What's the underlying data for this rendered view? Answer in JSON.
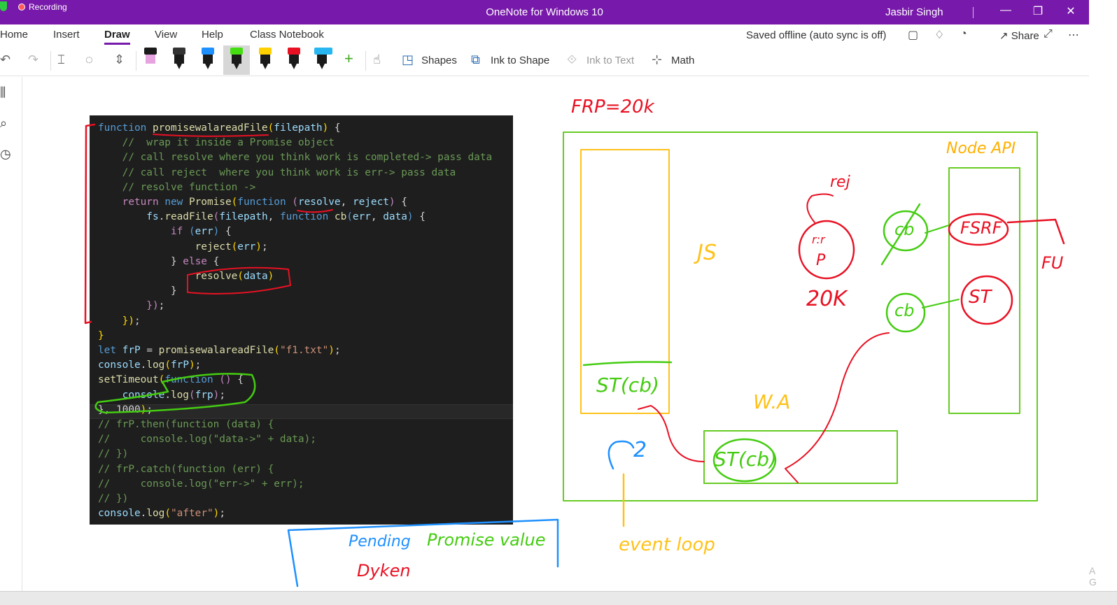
{
  "titlebar": {
    "recording": "Recording",
    "title": "OneNote for Windows 10",
    "user": "Jasbir Singh",
    "minimize": "—",
    "maximize": "❐",
    "close": "✕"
  },
  "ribbon": {
    "tabs": [
      "Home",
      "Insert",
      "Draw",
      "View",
      "Help",
      "Class Notebook"
    ],
    "active_tab": "Draw",
    "status": "Saved offline (auto sync is off)",
    "share": "Share",
    "more": "⋯"
  },
  "toolbar": {
    "shapes": "Shapes",
    "ink_to_shape": "Ink to Shape",
    "ink_to_text": "Ink to Text",
    "math": "Math",
    "add_pen": "+",
    "pens": [
      {
        "color": "#e7a3e0",
        "name": "pink-highlighter-pen"
      },
      {
        "color": "#222222",
        "name": "black-pen"
      },
      {
        "color": "#1e90ff",
        "name": "blue-pen"
      },
      {
        "color": "#44dd11",
        "name": "green-pen"
      },
      {
        "color": "#ffd000",
        "name": "yellow-pen"
      },
      {
        "color": "#e81123",
        "name": "red-pen"
      },
      {
        "color": "#27b6f0",
        "name": "cyan-pen"
      }
    ],
    "selected_pen": "green-pen"
  },
  "code": {
    "lines": [
      [
        [
          "k",
          "function "
        ],
        [
          "f",
          "promisewalareadFile"
        ],
        [
          "br",
          "("
        ],
        [
          "v",
          "filepath"
        ],
        [
          "br",
          ")"
        ],
        [
          "p",
          " {"
        ]
      ],
      [
        [
          "c",
          "    //  wrap it inside a Promise object"
        ]
      ],
      [
        [
          "c",
          "    // call resolve where you think work is completed-> pass data"
        ]
      ],
      [
        [
          "c",
          "    // call reject  where you think work is err-> pass data"
        ]
      ],
      [
        [
          "c",
          "    // resolve function ->"
        ]
      ],
      [
        [
          "kw2",
          "    return "
        ],
        [
          "k",
          "new "
        ],
        [
          "f",
          "Promise"
        ],
        [
          "br",
          "("
        ],
        [
          "k",
          "function "
        ],
        [
          "kw2",
          "("
        ],
        [
          "v",
          "resolve"
        ],
        [
          "p",
          ", "
        ],
        [
          "v",
          "reject"
        ],
        [
          "kw2",
          ")"
        ],
        [
          "p",
          " {"
        ]
      ],
      [
        [
          "v",
          "        fs"
        ],
        [
          "p",
          "."
        ],
        [
          "f",
          "readFile"
        ],
        [
          "kw2",
          "("
        ],
        [
          "v",
          "filepath"
        ],
        [
          "p",
          ", "
        ],
        [
          "k",
          "function "
        ],
        [
          "f",
          "cb"
        ],
        [
          "k",
          "("
        ],
        [
          "v",
          "err"
        ],
        [
          "p",
          ", "
        ],
        [
          "v",
          "data"
        ],
        [
          "k",
          ")"
        ],
        [
          "p",
          " {"
        ]
      ],
      [
        [
          "kw2",
          "            if "
        ],
        [
          "k",
          "("
        ],
        [
          "v",
          "err"
        ],
        [
          "k",
          ")"
        ],
        [
          "p",
          " {"
        ]
      ],
      [
        [
          "f",
          "                reject"
        ],
        [
          "br",
          "("
        ],
        [
          "v",
          "err"
        ],
        [
          "br",
          ")"
        ],
        [
          "p",
          ";"
        ]
      ],
      [
        [
          "p",
          "            } "
        ],
        [
          "kw2",
          "else"
        ],
        [
          "p",
          " {"
        ]
      ],
      [
        [
          "f",
          "                resolve"
        ],
        [
          "br",
          "("
        ],
        [
          "v",
          "data"
        ],
        [
          "br",
          ")"
        ]
      ],
      [
        [
          "p",
          "            }"
        ]
      ],
      [
        [
          "kw2",
          "        })"
        ],
        [
          "p",
          ";"
        ]
      ],
      [
        [
          "br",
          "    })"
        ],
        [
          "p",
          ";"
        ]
      ],
      [
        [
          "br",
          "}"
        ]
      ],
      [
        [
          "k",
          "let "
        ],
        [
          "v",
          "frP"
        ],
        [
          "p",
          " = "
        ],
        [
          "f",
          "promisewalareadFile"
        ],
        [
          "br",
          "("
        ],
        [
          "s",
          "\"f1.txt\""
        ],
        [
          "br",
          ")"
        ],
        [
          "p",
          ";"
        ]
      ],
      [
        [
          "v",
          "console"
        ],
        [
          "p",
          "."
        ],
        [
          "f",
          "log"
        ],
        [
          "br",
          "("
        ],
        [
          "v",
          "frP"
        ],
        [
          "br",
          ")"
        ],
        [
          "p",
          ";"
        ]
      ],
      [
        [
          "f",
          "setTimeout"
        ],
        [
          "br",
          "("
        ],
        [
          "k",
          "function "
        ],
        [
          "kw2",
          "()"
        ],
        [
          "p",
          " {"
        ]
      ],
      [
        [
          "v",
          "    console"
        ],
        [
          "p",
          "."
        ],
        [
          "f",
          "log"
        ],
        [
          "kw2",
          "("
        ],
        [
          "v",
          "frp"
        ],
        [
          "kw2",
          ")"
        ],
        [
          "p",
          ";"
        ]
      ],
      [
        [
          "p",
          "}, "
        ],
        [
          "p",
          "1000"
        ],
        [
          "br",
          ")"
        ],
        [
          "p",
          ";"
        ]
      ],
      [
        [
          "c",
          "// frP.then(function (data) {"
        ]
      ],
      [
        [
          "c",
          "//     console.log(\"data->\" + data);"
        ]
      ],
      [
        [
          "c",
          "// })"
        ]
      ],
      [
        [
          "c",
          "// frP.catch(function (err) {"
        ]
      ],
      [
        [
          "c",
          "//     console.log(\"err->\" + err);"
        ]
      ],
      [
        [
          "c",
          "// })"
        ]
      ],
      [
        [
          "v",
          "console"
        ],
        [
          "p",
          "."
        ],
        [
          "f",
          "log"
        ],
        [
          "br",
          "("
        ],
        [
          "s",
          "\"after\""
        ],
        [
          "br",
          ")"
        ],
        [
          "p",
          ";"
        ]
      ]
    ]
  },
  "ink": {
    "frp": "FRP=20k",
    "node_api": "Node API",
    "js": "JS",
    "rej": "rej",
    "res_p": "res\nP",
    "p": "P",
    "twenty_k": "20K",
    "cb_top": "cb",
    "cb_bottom": "cb",
    "fsrf": "FSRF",
    "st": "ST",
    "fu": "FU",
    "stack_cb": "ST(cb)",
    "wa": "W.A",
    "queue_cb": "ST(cb)",
    "loop": "2",
    "event_loop": "event loop",
    "pending": "Pending",
    "dyken": "Dyken",
    "promise_value": "Promise value"
  }
}
